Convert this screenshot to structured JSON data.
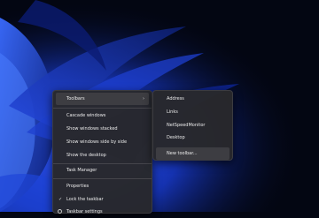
{
  "context_menu": {
    "toolbars_label": "Toolbars",
    "cascade_label": "Cascade windows",
    "stacked_label": "Show windows stacked",
    "side_by_side_label": "Show windows side by side",
    "desktop_label": "Show the desktop",
    "task_manager_label": "Task Manager",
    "properties_label": "Properties",
    "lock_label": "Lock the taskbar",
    "taskbar_settings_label": "Taskbar settings"
  },
  "toolbars_submenu": {
    "address_label": "Address",
    "links_label": "Links",
    "netspeed_label": "NetSpeedMonitor",
    "desktop_label": "Desktop",
    "new_toolbar_label": "New toolbar..."
  },
  "colors": {
    "menu_background": "#28282b",
    "menu_hover": "#3d3d42",
    "menu_text": "#ececec",
    "wallpaper_dark": "#030612",
    "wallpaper_blue": "#1b3cc9"
  },
  "icons": {
    "submenu_arrow": "chevron-right-icon",
    "lock_check": "checkmark-icon",
    "settings": "gear-icon"
  }
}
